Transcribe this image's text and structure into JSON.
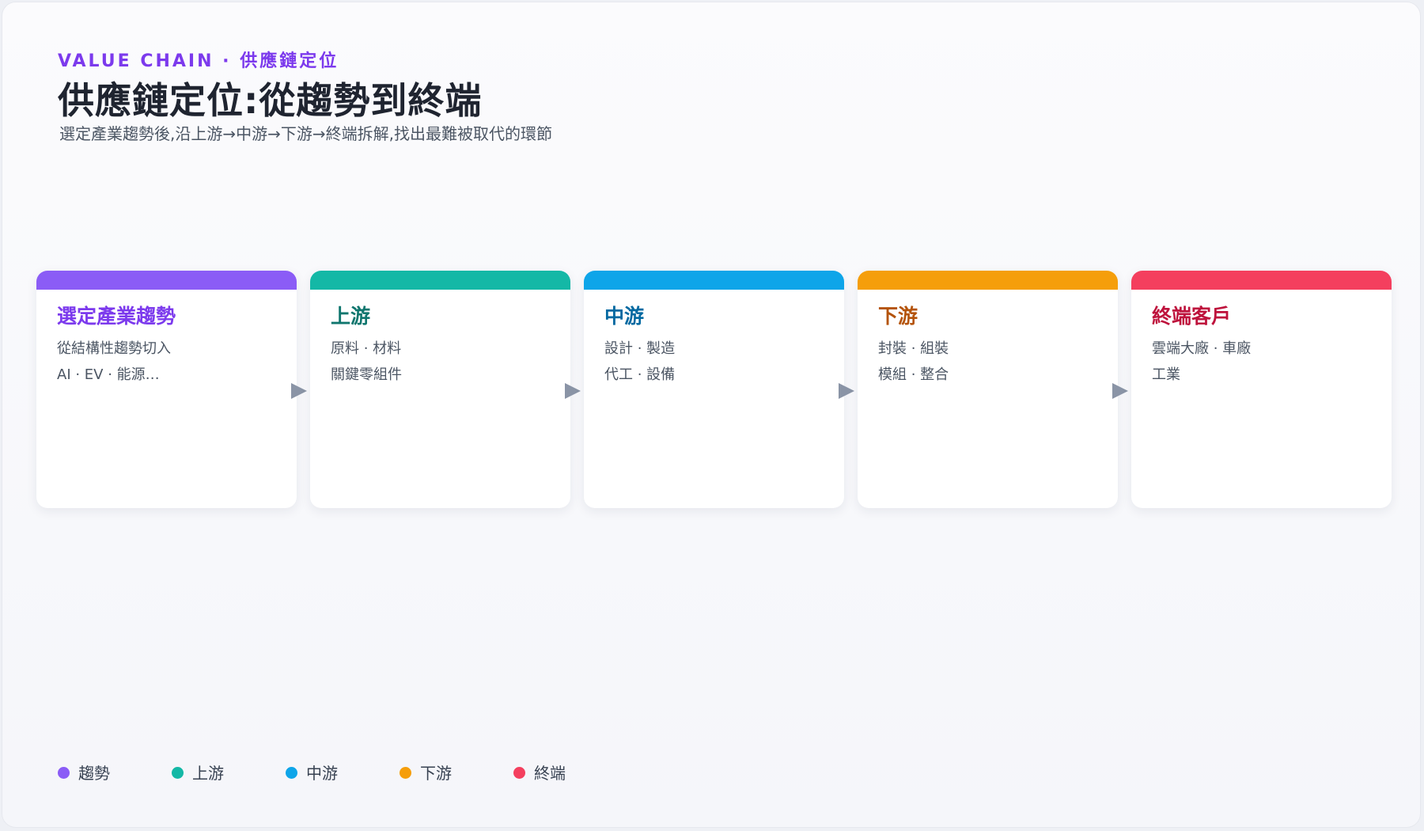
{
  "header": {
    "eyebrow": "VALUE CHAIN · 供應鏈定位",
    "title": "供應鏈定位:從趨勢到終端",
    "subtitle": "選定產業趨勢後,沿上游→中游→下游→終端拆解,找出最難被取代的環節"
  },
  "stages": [
    {
      "title": "選定產業趨勢",
      "lines": [
        "從結構性趨勢切入",
        "AI · EV · 能源…"
      ],
      "color": "#8b5cf6",
      "title_color": "#7c3aed"
    },
    {
      "title": "上游",
      "lines": [
        "原料 · 材料",
        "關鍵零組件"
      ],
      "color": "#14b8a6",
      "title_color": "#0f766e"
    },
    {
      "title": "中游",
      "lines": [
        "設計 · 製造",
        "代工 · 設備"
      ],
      "color": "#0ea5e9",
      "title_color": "#0369a1"
    },
    {
      "title": "下游",
      "lines": [
        "封裝 · 組裝",
        "模組 · 整合"
      ],
      "color": "#f59e0b",
      "title_color": "#b45309"
    },
    {
      "title": "終端客戶",
      "lines": [
        "雲端大廠 · 車廠",
        "工業"
      ],
      "color": "#f43f5e",
      "title_color": "#be123c"
    }
  ],
  "legend": [
    {
      "label": "趨勢",
      "color": "#8b5cf6"
    },
    {
      "label": "上游",
      "color": "#14b8a6"
    },
    {
      "label": "中游",
      "color": "#0ea5e9"
    },
    {
      "label": "下游",
      "color": "#f59e0b"
    },
    {
      "label": "終端",
      "color": "#f43f5e"
    }
  ]
}
